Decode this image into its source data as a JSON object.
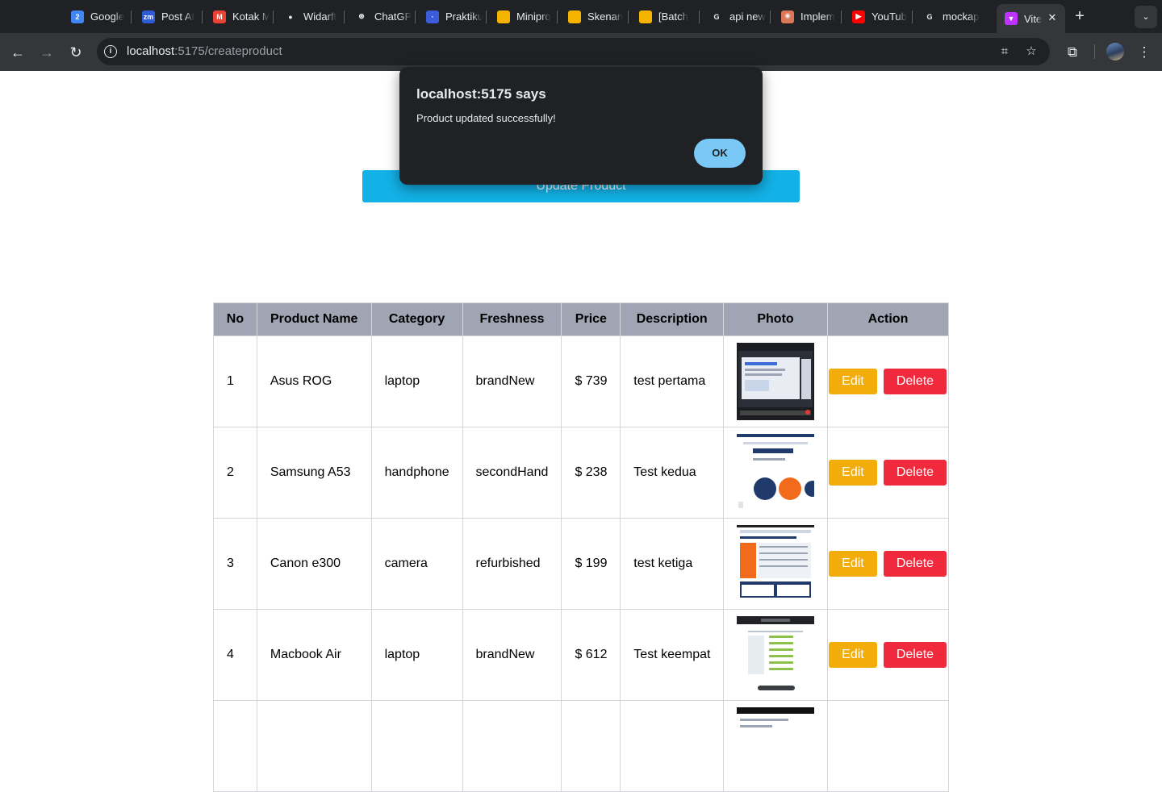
{
  "browser": {
    "tabs": [
      {
        "title": "Google",
        "icon": "google-calendar-icon",
        "color": "#4285f4",
        "glyph": "2"
      },
      {
        "title": "Post At",
        "icon": "zoom-icon",
        "color": "#2d5bd6",
        "glyph": "zm"
      },
      {
        "title": "Kotak M",
        "icon": "gmail-icon",
        "color": "#ea4335",
        "glyph": "M"
      },
      {
        "title": "Widarft",
        "icon": "github-icon",
        "color": "#ffffff",
        "glyph": "●"
      },
      {
        "title": "ChatGP",
        "icon": "chatgpt-icon",
        "color": "#ffffff",
        "glyph": "⊛"
      },
      {
        "title": "Praktiku",
        "icon": "praktikum-icon",
        "color": "#3b5bdb",
        "glyph": "·"
      },
      {
        "title": "Minipro",
        "icon": "google-slides-icon",
        "color": "#f4b400",
        "glyph": ""
      },
      {
        "title": "Skenari",
        "icon": "google-slides-icon",
        "color": "#f4b400",
        "glyph": ""
      },
      {
        "title": "[Batch",
        "icon": "google-slides-icon",
        "color": "#f4b400",
        "glyph": ""
      },
      {
        "title": "api new",
        "icon": "google-icon",
        "color": "#ffffff",
        "glyph": "G"
      },
      {
        "title": "Implem",
        "icon": "claude-icon",
        "color": "#d97757",
        "glyph": "✳"
      },
      {
        "title": "YouTub",
        "icon": "youtube-icon",
        "color": "#ff0000",
        "glyph": "▶"
      },
      {
        "title": "mockap",
        "icon": "google-icon",
        "color": "#ffffff",
        "glyph": "G"
      },
      {
        "title": "Vite",
        "icon": "vite-icon",
        "color": "#bd34fe",
        "glyph": "▼",
        "active": true
      }
    ],
    "url_host": "localhost",
    "url_path": ":5175/createproduct"
  },
  "page": {
    "update_button_label": "Update Product"
  },
  "table": {
    "headers": {
      "no": "No",
      "name": "Product Name",
      "category": "Category",
      "freshness": "Freshness",
      "price": "Price",
      "description": "Description",
      "photo": "Photo",
      "action": "Action"
    },
    "edit_label": "Edit",
    "delete_label": "Delete",
    "rows": [
      {
        "no": "1",
        "name": "Asus ROG",
        "category": "laptop",
        "freshness": "brandNew",
        "price": "$ 739",
        "description": "test pertama"
      },
      {
        "no": "2",
        "name": "Samsung A53",
        "category": "handphone",
        "freshness": "secondHand",
        "price": "$ 238",
        "description": "Test kedua"
      },
      {
        "no": "3",
        "name": "Canon e300",
        "category": "camera",
        "freshness": "refurbished",
        "price": "$ 199",
        "description": "test ketiga"
      },
      {
        "no": "4",
        "name": "Macbook Air",
        "category": "laptop",
        "freshness": "brandNew",
        "price": "$ 612",
        "description": "Test keempat"
      }
    ]
  },
  "dialog": {
    "title": "localhost:5175 says",
    "message": "Product updated successfully!",
    "ok_label": "OK"
  },
  "colors": {
    "update_button": "#12b1e6",
    "table_header": "#a0a5b4",
    "edit_button": "#f2ad0a",
    "delete_button": "#f0293d",
    "dialog_ok": "#79c8f5"
  }
}
